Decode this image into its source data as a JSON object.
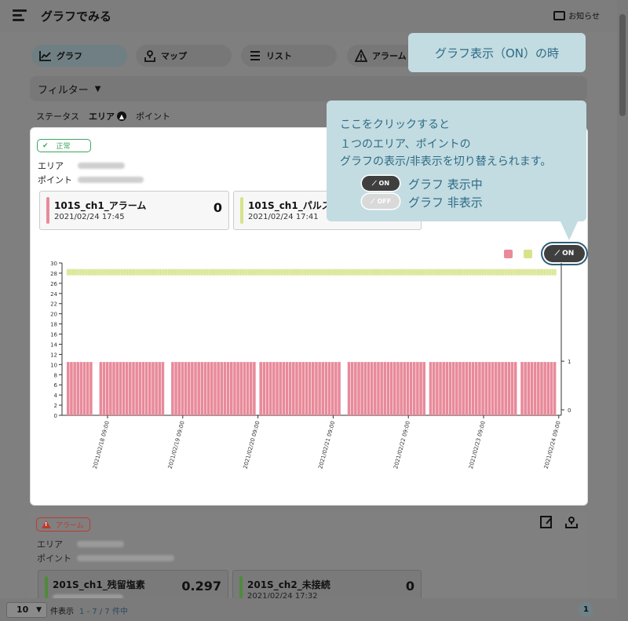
{
  "header": {
    "title": "グラフでみる",
    "notice_label": "お知らせ"
  },
  "tabs": [
    {
      "label": "グラフ",
      "icon": "chart-icon",
      "active": true
    },
    {
      "label": "マップ",
      "icon": "map-pin-icon",
      "active": false
    },
    {
      "label": "リスト",
      "icon": "list-icon",
      "active": false
    },
    {
      "label": "アラーム",
      "icon": "warning-icon",
      "active": false
    }
  ],
  "filter": {
    "label": "フィルター",
    "arrow": "▼"
  },
  "sort": {
    "status": "ステータス",
    "area": "エリア",
    "point": "ポイント"
  },
  "card1": {
    "status_label": "正常",
    "area_label": "エリア",
    "point_label": "ポイント",
    "sensors": [
      {
        "name": "101S_ch1_アラーム",
        "time": "2021/02/24 17:45",
        "value": "0",
        "color": "#e88a9a"
      },
      {
        "name": "101S_ch1_パルス",
        "time": "2021/02/24 17:41",
        "value": "",
        "color": "#d7e38a"
      }
    ],
    "toggle_label": "ON"
  },
  "chart_data": {
    "type": "bar",
    "title": "",
    "y_left": {
      "ticks": [
        0,
        2,
        4,
        6,
        8,
        10,
        12,
        14,
        16,
        18,
        20,
        22,
        24,
        26,
        28,
        30
      ],
      "ylim": [
        0,
        30
      ]
    },
    "y_right": {
      "ticks": [
        0,
        1
      ],
      "ylim": [
        0,
        3
      ]
    },
    "x_tick_labels": [
      "2021/02/18 09:00",
      "2021/02/19 09:00",
      "2021/02/20 09:00",
      "2021/02/21 09:00",
      "2021/02/22 09:00",
      "2021/02/23 09:00",
      "2021/02/24 09:00"
    ],
    "series": [
      {
        "color": "#e88a9a",
        "value": 10.5,
        "axis": "left"
      },
      {
        "color": "#d7e38a",
        "value": 28.5,
        "axis": "left"
      }
    ],
    "grid": false
  },
  "card2": {
    "status_label": "アラーム",
    "area_label": "エリア",
    "point_label": "ポイント",
    "sensors": [
      {
        "name": "201S_ch1_残留塩素",
        "time": "",
        "value": "0.297",
        "color": "#4f8a3b"
      },
      {
        "name": "201S_ch2_未接続",
        "time": "2021/02/24 17:32",
        "value": "0",
        "color": "#4f8a3b"
      }
    ]
  },
  "footer": {
    "page_size": "10",
    "per_page_label": "件表示",
    "range": "1 - 7 / 7 件中",
    "page": "1"
  },
  "callouts": {
    "top": "グラフ表示（ON）の時",
    "main_lines": [
      "ここをクリックすると",
      "１つのエリア、ポイントの",
      "グラフの表示/非表示を切り替えられます。"
    ],
    "on_label": "グラフ 表示中",
    "off_label": "グラフ 非表示",
    "pill_on": "ON",
    "pill_off": "OFF"
  }
}
